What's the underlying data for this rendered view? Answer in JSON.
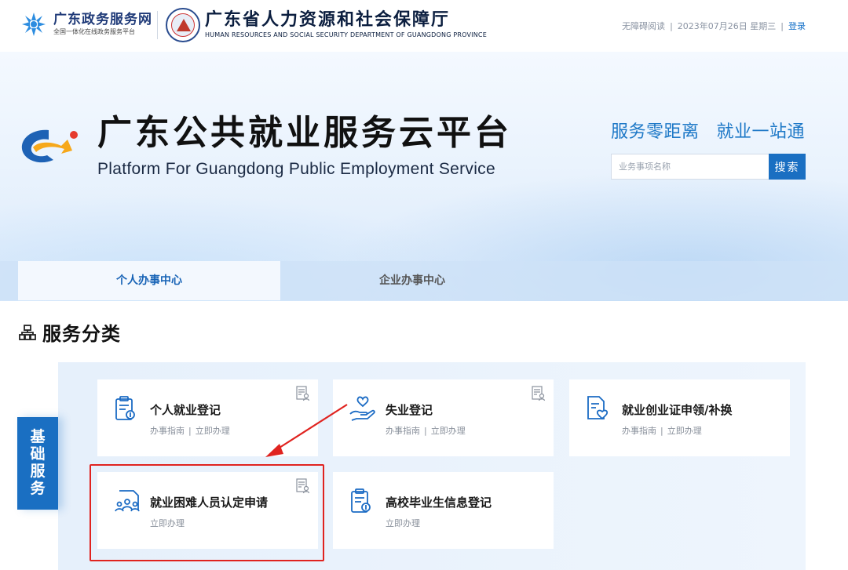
{
  "header": {
    "gov_portal": {
      "name": "广东政务服务网",
      "subtitle": "全国一体化在线政务服务平台"
    },
    "department": {
      "name_cn": "广东省人力资源和社会保障厅",
      "name_en": "HUMAN RESOURCES AND SOCIAL SECURITY DEPARTMENT OF GUANGDONG PROVINCE"
    },
    "links": {
      "accessibility": "无障碍阅读",
      "date": "2023年07月26日 星期三",
      "login": "登录"
    }
  },
  "banner": {
    "title": "广东公共就业服务云平台",
    "subtitle": "Platform For Guangdong Public Employment Service",
    "slogans": [
      "服务零距离",
      "就业一站通"
    ],
    "search": {
      "placeholder": "业务事项名称",
      "button": "搜索"
    }
  },
  "tabs": [
    {
      "label": "个人办事中心",
      "active": true
    },
    {
      "label": "企业办事中心",
      "active": false
    }
  ],
  "section": {
    "title": "服务分类",
    "category": [
      "基",
      "础",
      "服",
      "务"
    ]
  },
  "cards": [
    {
      "title": "个人就业登记",
      "links": [
        "办事指南",
        "立即办理"
      ],
      "icon": "clipboard-badge-icon"
    },
    {
      "title": "失业登记",
      "links": [
        "办事指南",
        "立即办理"
      ],
      "icon": "hand-heart-icon"
    },
    {
      "title": "就业创业证申领/补换",
      "links": [
        "办事指南",
        "立即办理"
      ],
      "icon": "document-heart-icon"
    },
    {
      "title": "就业困难人员认定申请",
      "links": [
        "立即办理"
      ],
      "icon": "people-group-icon"
    },
    {
      "title": "高校毕业生信息登记",
      "links": [
        "立即办理"
      ],
      "icon": "clipboard-badge-icon"
    }
  ],
  "colors": {
    "primary": "#1a6fc2",
    "slogan": "#1d78c7",
    "highlight": "#e0231f"
  }
}
